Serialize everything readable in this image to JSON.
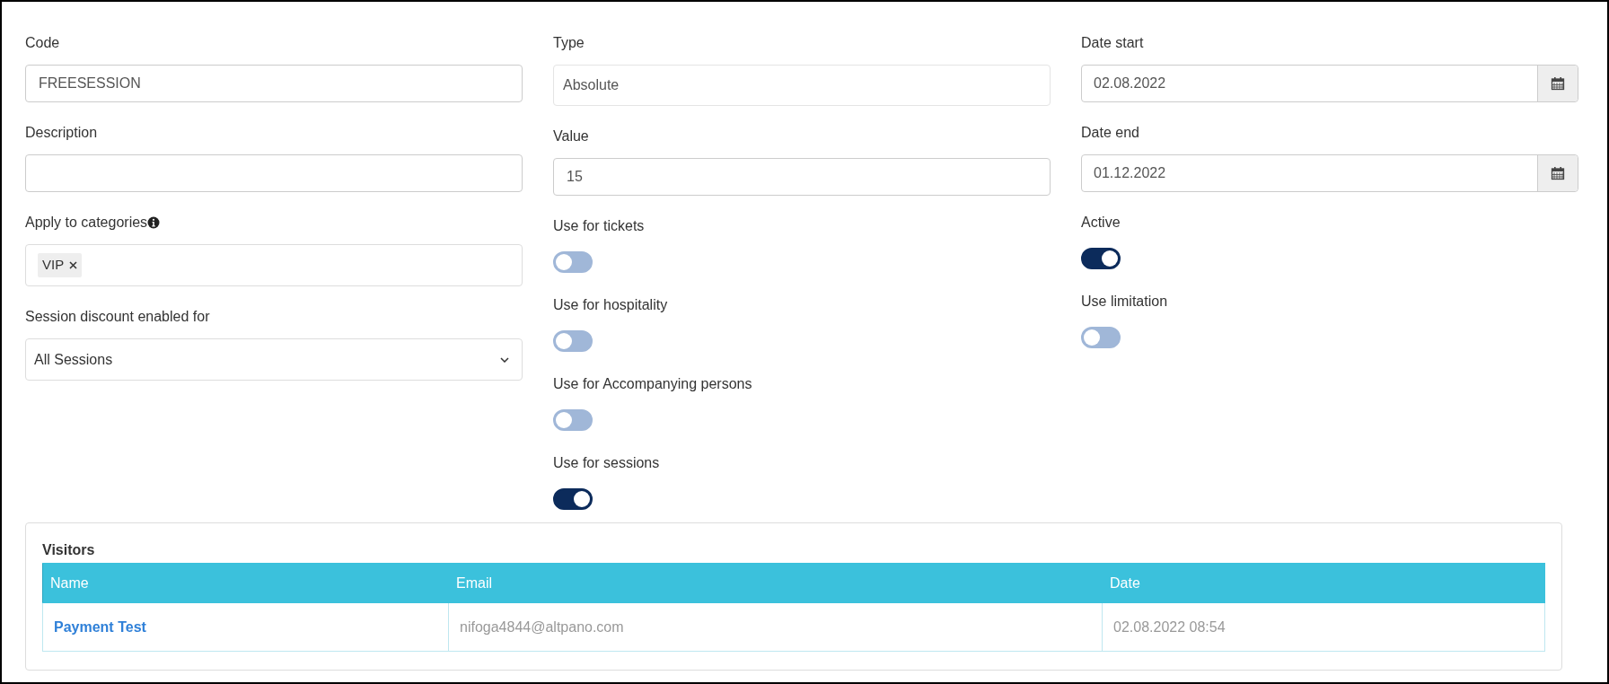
{
  "columns": [
    [
      {
        "kind": "text",
        "label": "Code",
        "value": "FREESESSION"
      },
      {
        "kind": "text",
        "label": "Description"
      },
      {
        "kind": "tags",
        "label": "Apply to categories",
        "tags": [
          "VIP"
        ]
      },
      {
        "kind": "select",
        "label": "Session discount enabled for",
        "value": "All Sessions"
      }
    ],
    [
      {
        "kind": "readonly",
        "label": "Type",
        "value": "Absolute"
      },
      {
        "kind": "text",
        "label": "Value",
        "value": "15"
      },
      {
        "kind": "toggle",
        "label": "Use for tickets",
        "on": false
      },
      {
        "kind": "toggle",
        "label": "Use for hospitality",
        "on": false
      },
      {
        "kind": "toggle",
        "label": "Use for Accompanying persons",
        "on": false
      },
      {
        "kind": "toggle",
        "label": "Use for sessions",
        "on": true
      }
    ],
    [
      {
        "kind": "date",
        "label": "Date start",
        "value": "02.08.2022"
      },
      {
        "kind": "date",
        "label": "Date end",
        "value": "01.12.2022"
      },
      {
        "kind": "toggle",
        "label": "Active",
        "on": true
      },
      {
        "kind": "toggle",
        "label": "Use limitation",
        "on": false
      }
    ]
  ],
  "visitors": {
    "title": "Visitors",
    "columns": [
      "Name",
      "Email",
      "Date"
    ],
    "rows": [
      [
        "Payment Test",
        "nifoga4844@altpano.com",
        "02.08.2022 08:54"
      ]
    ]
  }
}
